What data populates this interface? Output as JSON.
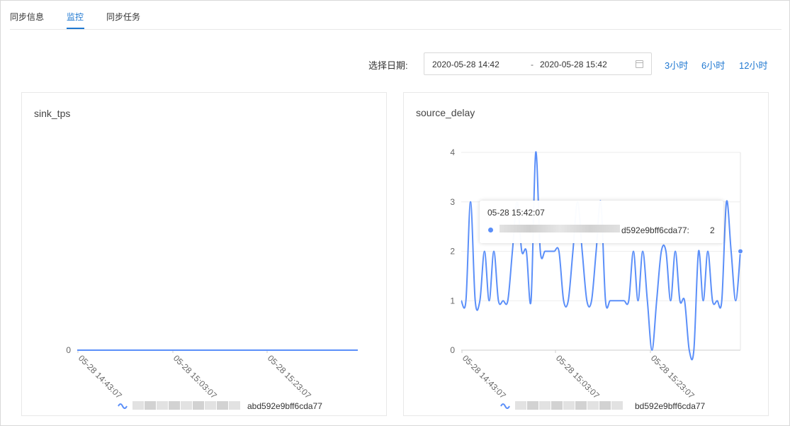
{
  "tabs": [
    {
      "label": "同步信息",
      "active": false
    },
    {
      "label": "监控",
      "active": true
    },
    {
      "label": "同步任务",
      "active": false
    }
  ],
  "toolbar": {
    "date_label": "选择日期:",
    "start": "2020-05-28 14:42",
    "separator": "-",
    "end": "2020-05-28 15:42",
    "quick_ranges": [
      "3小时",
      "6小时",
      "12小时"
    ]
  },
  "colors": {
    "accent": "#1f78d1",
    "series": "#5b8ff9"
  },
  "charts": [
    {
      "title": "sink_tps",
      "legend_suffix": "abd592e9bff6cda77",
      "chart_data": {
        "type": "line",
        "title": "sink_tps",
        "x_ticks": [
          "05-28 14:43:07",
          "05-28 15:03:07",
          "05-28 15:23:07"
        ],
        "y_ticks": [
          0
        ],
        "ylim": [
          0,
          0
        ],
        "series": [
          {
            "values": [
              0,
              0,
              0,
              0,
              0,
              0,
              0,
              0,
              0,
              0,
              0,
              0,
              0,
              0,
              0,
              0,
              0,
              0,
              0,
              0,
              0,
              0,
              0,
              0,
              0,
              0,
              0,
              0,
              0,
              0,
              0,
              0,
              0,
              0,
              0,
              0,
              0,
              0,
              0,
              0,
              0,
              0,
              0,
              0,
              0,
              0,
              0,
              0,
              0,
              0,
              0,
              0,
              0,
              0,
              0,
              0,
              0,
              0,
              0,
              0
            ]
          }
        ],
        "grid": false
      }
    },
    {
      "title": "source_delay",
      "legend_suffix": "bd592e9bff6cda77",
      "chart_data": {
        "type": "line",
        "title": "source_delay",
        "x_ticks": [
          "05-28 14:43:07",
          "05-28 15:03:07",
          "05-28 15:23:07"
        ],
        "y_ticks": [
          0,
          1,
          2,
          3,
          4
        ],
        "ylim": [
          0,
          4
        ],
        "series": [
          {
            "values": [
              1,
              1,
              3,
              1,
              1,
              2,
              1,
              2,
              1,
              1,
              1,
              2,
              3,
              2,
              2,
              1,
              4,
              2,
              2,
              2,
              2,
              2,
              1,
              1,
              2,
              3,
              2,
              1,
              1,
              2,
              3,
              1,
              1,
              1,
              1,
              1,
              1,
              2,
              1,
              2,
              1,
              0,
              1,
              2,
              2,
              1,
              2,
              1,
              1,
              0,
              0,
              2,
              1,
              2,
              1,
              1,
              1,
              3,
              2,
              1,
              2
            ]
          }
        ],
        "grid": true
      },
      "tooltip": {
        "time": "05-28 15:42:07",
        "series_suffix": "d592e9bff6cda77:",
        "value": "2"
      }
    }
  ]
}
